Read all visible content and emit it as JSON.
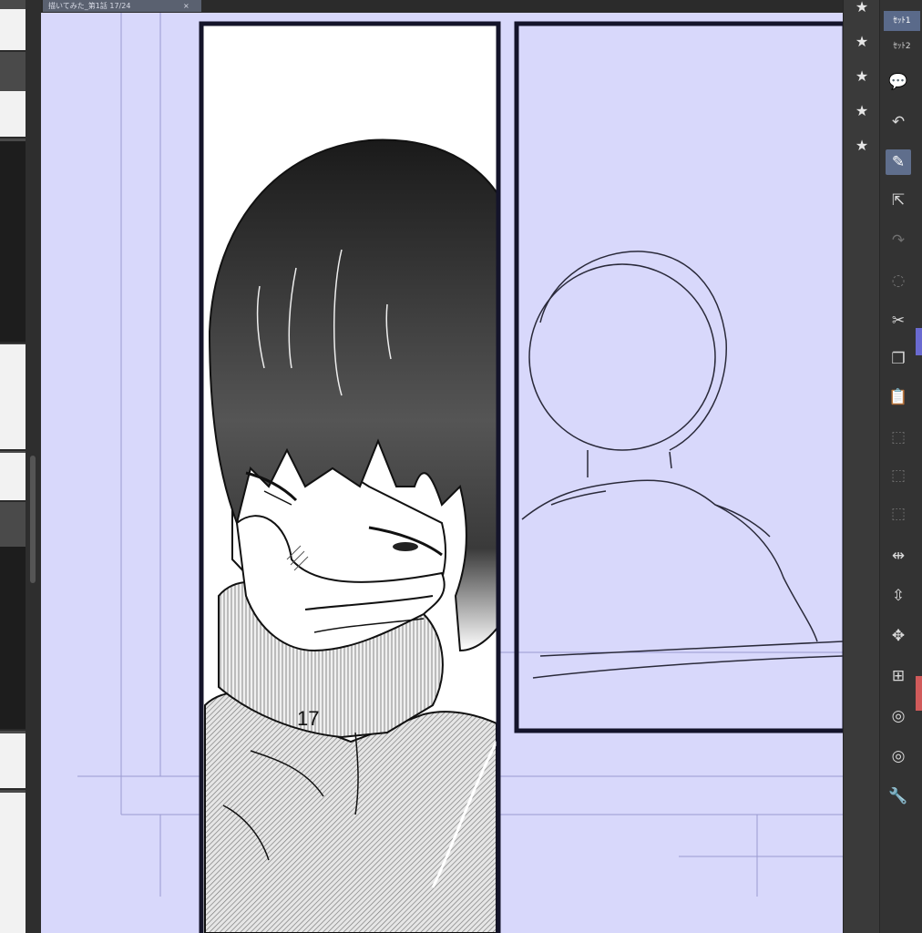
{
  "document_tab": {
    "title": "描いてみた_第1話 17/24",
    "close": "×"
  },
  "page": {
    "number": "17"
  },
  "tool_sets": [
    {
      "label": "ｾｯﾄ1",
      "active": true
    },
    {
      "label": "ｾｯﾄ2",
      "active": false
    }
  ],
  "sub_tool_buttons": [
    {
      "name": "material-folder-1-icon",
      "glyph": "★"
    },
    {
      "name": "material-folder-2-icon",
      "glyph": "★"
    },
    {
      "name": "material-folder-3-icon",
      "glyph": "★"
    },
    {
      "name": "material-folder-4-icon",
      "glyph": "★"
    },
    {
      "name": "material-folder-5-icon",
      "glyph": "★"
    }
  ],
  "tools": [
    {
      "name": "speech-balloon-icon",
      "glyph": "💬",
      "active": false
    },
    {
      "name": "undo-icon",
      "glyph": "↶",
      "active": false
    },
    {
      "name": "pen-tool-icon",
      "glyph": "✎",
      "active": true
    },
    {
      "name": "select-move-icon",
      "glyph": "⇱",
      "active": false
    },
    {
      "name": "redo-icon",
      "glyph": "↷",
      "active": false,
      "dim": true
    },
    {
      "name": "lasso-icon",
      "glyph": "◌",
      "active": false,
      "dim": true
    },
    {
      "name": "cut-icon",
      "glyph": "✂",
      "active": false
    },
    {
      "name": "copy-icon",
      "glyph": "❐",
      "active": false
    },
    {
      "name": "paste-icon",
      "glyph": "📋",
      "active": false
    },
    {
      "name": "clear-selection-icon",
      "glyph": "⬚",
      "active": false,
      "dim": true
    },
    {
      "name": "crop-icon",
      "glyph": "⬚",
      "active": false,
      "dim": true
    },
    {
      "name": "transform-icon",
      "glyph": "⬚",
      "active": false,
      "dim": true
    },
    {
      "name": "flip-horizontal-icon",
      "glyph": "⇹",
      "active": false
    },
    {
      "name": "flip-vertical-icon",
      "glyph": "⇳",
      "active": false
    },
    {
      "name": "rotate-canvas-icon",
      "glyph": "✥",
      "active": false
    },
    {
      "name": "new-layer-icon",
      "glyph": "⊞",
      "active": false
    },
    {
      "name": "layer-property-1-icon",
      "glyph": "◎",
      "active": false
    },
    {
      "name": "layer-property-2-icon",
      "glyph": "◎",
      "active": false
    },
    {
      "name": "settings-wrench-icon",
      "glyph": "🔧",
      "active": false
    }
  ],
  "colors": {
    "canvas": "#d8d8fb",
    "panel_border": "#14142a",
    "guide": "#9a9ad0",
    "accent": "#5f6e8c"
  }
}
